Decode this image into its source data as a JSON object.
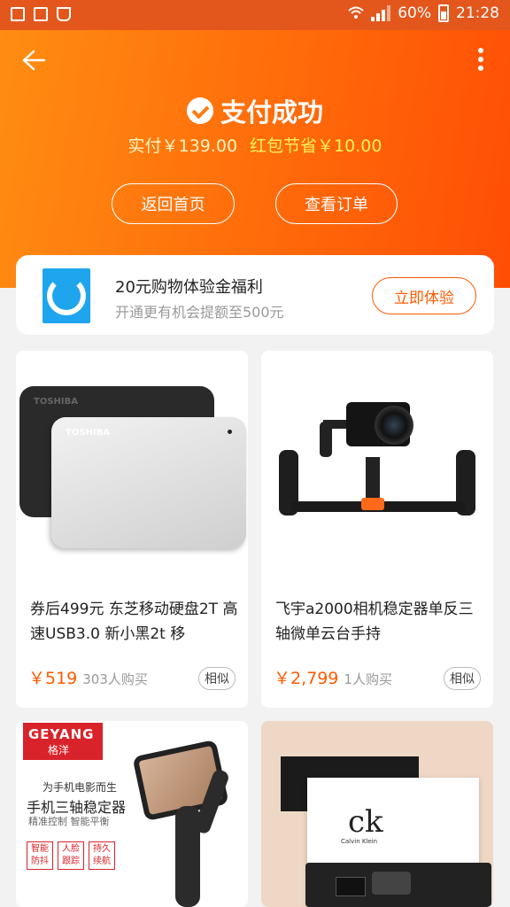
{
  "status_bar": {
    "battery": "60%",
    "time": "21:28"
  },
  "header": {
    "title": "支付成功",
    "paid": "实付￥139.00",
    "saved": "红包节省￥10.00",
    "home_button": "返回首页",
    "order_button": "查看订单"
  },
  "promo": {
    "title": "20元购物体验金福利",
    "subtitle": "开通更有机会提额至500元",
    "button": "立即体验"
  },
  "products": [
    {
      "title": "券后499元 东芝移动硬盘2T 高速USB3.0 新小黑2t 移",
      "price": "￥519",
      "buyers": "303人购买",
      "similar": "相似",
      "image_brand": "TOSHIBA"
    },
    {
      "title": "飞宇a2000相机稳定器单反三轴微单云台手持",
      "price": "￥2,799",
      "buyers": "1人购买",
      "similar": "相似"
    }
  ],
  "ads": {
    "geyang": {
      "brand": "GEYANG",
      "brand_cn": "格洋",
      "tagline": "为手机电影而生",
      "headline": "手机三轴稳定器",
      "features": "精准控制 智能平衡",
      "badges": [
        "智能防抖",
        "人脸跟踪",
        "持久续航"
      ]
    },
    "ck": {
      "logo": "ck",
      "sub": "Calvin Klein"
    }
  }
}
